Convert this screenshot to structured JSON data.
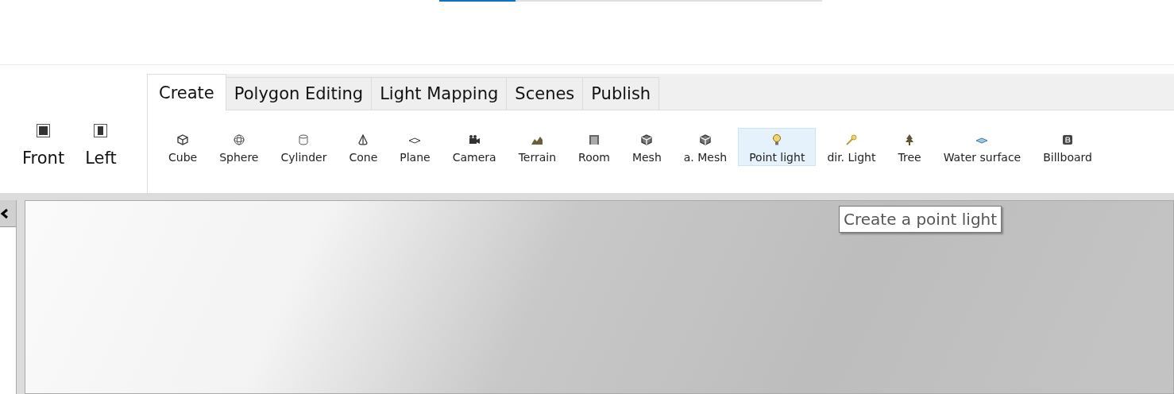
{
  "progress": {
    "level": 0.2
  },
  "views": [
    {
      "label": "Front",
      "kind": "front"
    },
    {
      "label": "Left",
      "kind": "left"
    }
  ],
  "tabs": [
    {
      "label": "Create",
      "selected": true
    },
    {
      "label": "Polygon Editing",
      "selected": false
    },
    {
      "label": "Light Mapping",
      "selected": false
    },
    {
      "label": "Scenes",
      "selected": false
    },
    {
      "label": "Publish",
      "selected": false
    }
  ],
  "tools": [
    {
      "label": "Cube",
      "kind": "cube",
      "selected": false
    },
    {
      "label": "Sphere",
      "kind": "sphere",
      "selected": false
    },
    {
      "label": "Cylinder",
      "kind": "cylinder",
      "selected": false
    },
    {
      "label": "Cone",
      "kind": "cone",
      "selected": false
    },
    {
      "label": "Plane",
      "kind": "plane",
      "selected": false
    },
    {
      "label": "Camera",
      "kind": "camera",
      "selected": false
    },
    {
      "label": "Terrain",
      "kind": "terrain",
      "selected": false
    },
    {
      "label": "Room",
      "kind": "room",
      "selected": false
    },
    {
      "label": "Mesh",
      "kind": "mesh",
      "selected": false
    },
    {
      "label": "a. Mesh",
      "kind": "amesh",
      "selected": false
    },
    {
      "label": "Point light",
      "kind": "bulb",
      "selected": true
    },
    {
      "label": "dir. Light",
      "kind": "dirlight",
      "selected": false
    },
    {
      "label": "Tree",
      "kind": "tree",
      "selected": false
    },
    {
      "label": "Water surface",
      "kind": "water",
      "selected": false
    },
    {
      "label": "Billboard",
      "kind": "billboard",
      "selected": false
    }
  ],
  "tooltip": {
    "text": "Create a point light"
  }
}
